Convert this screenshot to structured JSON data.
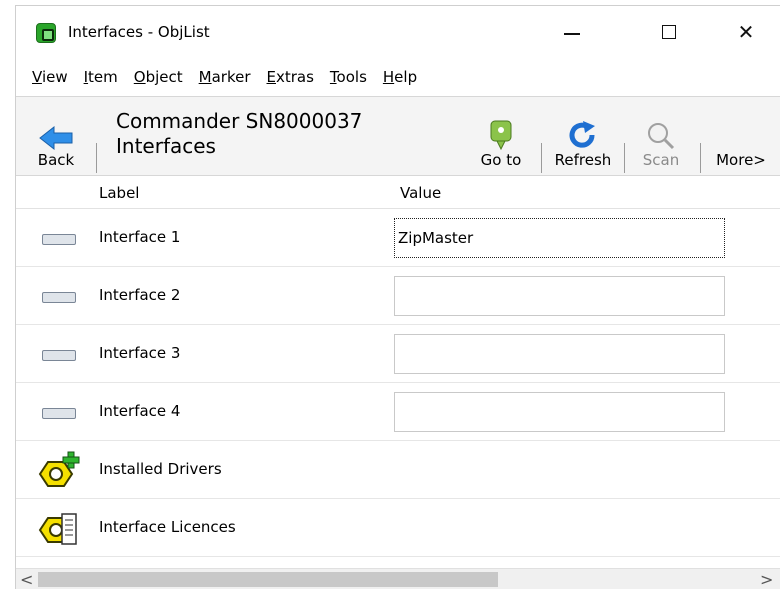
{
  "window": {
    "title": "Interfaces - ObjList",
    "minimize_glyph": "—",
    "close_glyph": "✕"
  },
  "menu": [
    {
      "label": "View",
      "accel": "V"
    },
    {
      "label": "Item",
      "accel": "I"
    },
    {
      "label": "Object",
      "accel": "O"
    },
    {
      "label": "Marker",
      "accel": "M"
    },
    {
      "label": "Extras",
      "accel": "E"
    },
    {
      "label": "Tools",
      "accel": "T"
    },
    {
      "label": "Help",
      "accel": "H"
    }
  ],
  "toolbar": {
    "back_label": "Back",
    "path_device": "Commander SN8000037",
    "path_section": "Interfaces",
    "goto_label": "Go to",
    "refresh_label": "Refresh",
    "scan_label": "Scan",
    "more_label": "More>"
  },
  "columns": {
    "label": "Label",
    "value": "Value"
  },
  "rows": [
    {
      "label": "Interface 1",
      "value": "ZipMaster",
      "icon": "interface-port-icon"
    },
    {
      "label": "Interface 2",
      "value": "",
      "icon": "interface-port-icon"
    },
    {
      "label": "Interface 3",
      "value": "",
      "icon": "interface-port-icon"
    },
    {
      "label": "Interface 4",
      "value": "",
      "icon": "interface-port-icon"
    },
    {
      "label": "Installed Drivers",
      "icon": "nut-plus-icon"
    },
    {
      "label": "Interface Licences",
      "icon": "nut-licence-icon"
    }
  ],
  "scrollbar": {
    "left_arrow": "<",
    "right_arrow": ">"
  }
}
